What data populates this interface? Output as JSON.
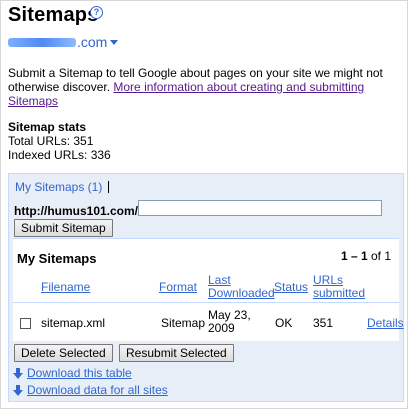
{
  "header": {
    "title": "Sitemaps",
    "help_glyph": "?",
    "site_suffix": ".com"
  },
  "intro": {
    "text": "Submit a Sitemap to tell Google about pages on your site we might not otherwise discover.",
    "link": "More information about creating and submitting Sitemaps"
  },
  "stats": {
    "heading": "Sitemap stats",
    "total": "Total URLs: 351",
    "indexed": "Indexed URLs: 336"
  },
  "panel": {
    "tab_label": "My Sitemaps (1)",
    "url_prefix": "http://humus101.com/",
    "url_value": "",
    "submit_button": "Submit Sitemap",
    "table_title": "My Sitemaps",
    "pager_range": "1 – 1",
    "pager_of": "of 1",
    "columns": [
      "Filename",
      "Format",
      "Last Downloaded",
      "Status",
      "URLs submitted"
    ],
    "rows": [
      {
        "filename": "sitemap.xml",
        "format": "Sitemap",
        "last_downloaded": "May 23, 2009",
        "status": "OK",
        "urls_submitted": "351",
        "details": "Details"
      }
    ],
    "delete_button": "Delete Selected",
    "resubmit_button": "Resubmit Selected",
    "download_table": "Download this table",
    "download_all": "Download data for all sites"
  },
  "colors": {
    "link": "#3366cc",
    "visited_link": "#551a8b",
    "panel_bg": "#e8eef7",
    "panel_border": "#c3d9ff"
  }
}
